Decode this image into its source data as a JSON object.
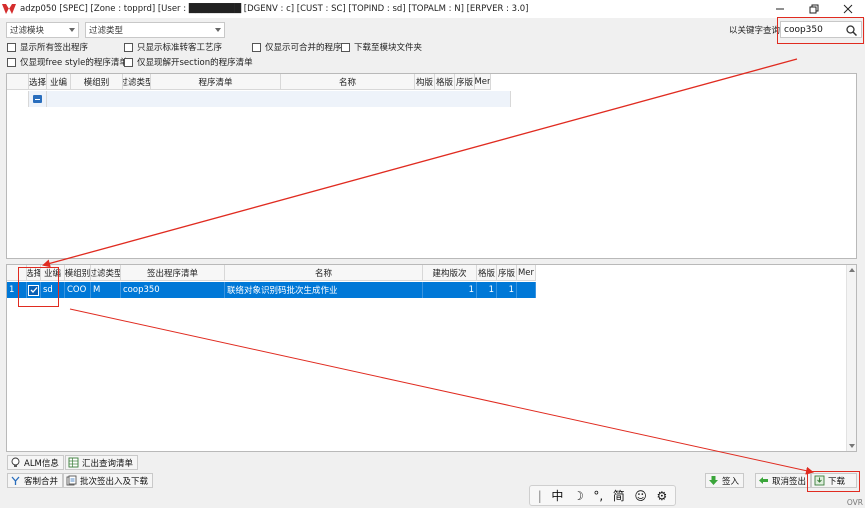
{
  "window": {
    "title": "adzp050 [SPEC] [Zone : topprd] [User : ████████ [DGENV : c] [CUST : SC] [TOPIND : sd] [TOPALM : N] [ERPVER : 3.0]",
    "controls": {
      "minimize": "—",
      "maximize": "❐",
      "close": "✕"
    }
  },
  "filters": {
    "module_filter": "过滤模块",
    "type_filter": "过滤类型",
    "keyword_label": "以关键字查询",
    "keyword_value": "coop350"
  },
  "options": {
    "show_all_checkout": "显示所有签出程序",
    "show_std_only": "只显示标准转客工艺序",
    "show_mergeable_only": "仅显示可合并的程序",
    "download_to_module": "下载至模块文件夹",
    "show_freestyle": "仅显现free style的程序清单",
    "show_unsection": "仅显现解开section的程序清单"
  },
  "top_grid": {
    "headers": [
      "选择",
      "业编",
      "模组别",
      "过滤类型",
      "程序清单",
      "名称",
      "构版",
      "格版",
      "序版",
      "Mer"
    ]
  },
  "bottom_grid": {
    "headers": [
      "选择",
      "业编",
      "模组别",
      "过滤类型",
      "签出程序清单",
      "名称",
      "建构版次",
      "格版",
      "序版",
      "Mer"
    ],
    "rows": [
      {
        "index": "1",
        "industry": "sd",
        "module": "COO",
        "type": "M",
        "program": "coop350",
        "name": "联络对象识别码批次生成作业",
        "build_ver": "1",
        "grid_ver": "1",
        "seq_ver": "1",
        "mer": ""
      }
    ]
  },
  "buttons": {
    "alm_info": "ALM信息",
    "export_list": "汇出查询清单",
    "custom_merge": "客制合并",
    "batch_checkout": "批次签出入及下载",
    "checkin": "签入",
    "cancel_checkout": "取消签出",
    "download": "下载"
  },
  "ime": {
    "cursor": "|",
    "lang": "中",
    "mode": "☽",
    "punct": "°,",
    "script": "简",
    "emoji": "☺",
    "settings": "⚙"
  },
  "status": {
    "ovr": "OVR"
  },
  "colors": {
    "selection": "#0078d7",
    "highlight": "#e02b20",
    "accent": "#2a6ebd"
  }
}
